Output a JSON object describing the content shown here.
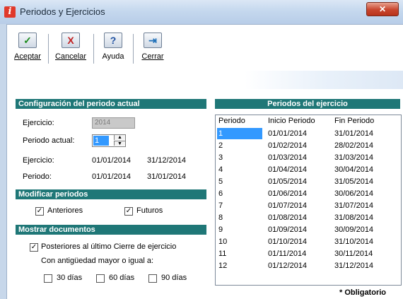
{
  "window": {
    "title": "Periodos y Ejercicios",
    "close_glyph": "✕"
  },
  "toolbar": {
    "buttons": [
      {
        "name": "aceptar",
        "label": "Aceptar",
        "icon": "check-icon",
        "glyph": "✓"
      },
      {
        "name": "cancelar",
        "label": "Cancelar",
        "icon": "cancel-x-icon",
        "glyph": "X"
      },
      {
        "name": "ayuda",
        "label": "Ayuda",
        "icon": "help-icon",
        "glyph": "?"
      },
      {
        "name": "cerrar",
        "label": "Cerrar",
        "icon": "exit-door-icon",
        "glyph": "⇥"
      }
    ]
  },
  "config": {
    "header": "Configuración del periodo actual",
    "ejercicio_label": "Ejercicio:",
    "ejercicio_value": "2014",
    "periodo_actual_label": "Periodo actual:",
    "periodo_actual_value": "1",
    "ejercicio_range_label": "Ejercicio:",
    "ejercicio_start": "01/01/2014",
    "ejercicio_end": "31/12/2014",
    "periodo_label": "Periodo:",
    "periodo_start": "01/01/2014",
    "periodo_end": "31/01/2014"
  },
  "modificar": {
    "header": "Modificar periodos",
    "anteriores": {
      "label": "Anteriores",
      "checked": true
    },
    "futuros": {
      "label": "Futuros",
      "checked": true
    }
  },
  "mostrar": {
    "header": "Mostrar documentos",
    "posteriores": {
      "label": "Posteriores al último Cierre de ejercicio",
      "checked": true
    },
    "antiguedad_label": "Con antigüedad mayor o igual a:",
    "d30": {
      "label": "30 días",
      "checked": false
    },
    "d60": {
      "label": "60 días",
      "checked": false
    },
    "d90": {
      "label": "90 días",
      "checked": false
    }
  },
  "periodos": {
    "header": "Periodos del ejercicio",
    "columns": [
      "Periodo",
      "Inicio Periodo",
      "Fin Periodo"
    ],
    "rows": [
      [
        "1",
        "01/01/2014",
        "31/01/2014"
      ],
      [
        "2",
        "01/02/2014",
        "28/02/2014"
      ],
      [
        "3",
        "01/03/2014",
        "31/03/2014"
      ],
      [
        "4",
        "01/04/2014",
        "30/04/2014"
      ],
      [
        "5",
        "01/05/2014",
        "31/05/2014"
      ],
      [
        "6",
        "01/06/2014",
        "30/06/2014"
      ],
      [
        "7",
        "01/07/2014",
        "31/07/2014"
      ],
      [
        "8",
        "01/08/2014",
        "31/08/2014"
      ],
      [
        "9",
        "01/09/2014",
        "30/09/2014"
      ],
      [
        "10",
        "01/10/2014",
        "31/10/2014"
      ],
      [
        "11",
        "01/11/2014",
        "30/11/2014"
      ],
      [
        "12",
        "01/12/2014",
        "31/12/2014"
      ]
    ],
    "selected_index": 0
  },
  "footer": {
    "note": "* Obligatorio"
  },
  "colors": {
    "panel_header": "#1f7777",
    "selection": "#3399ff"
  }
}
